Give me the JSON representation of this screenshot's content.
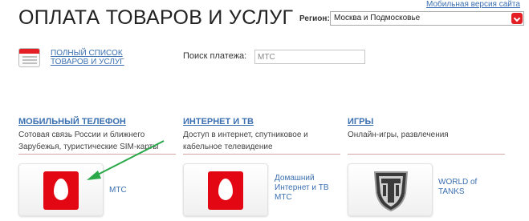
{
  "header": {
    "mobile_version": "Мобильная версия сайта",
    "title": "ОПЛАТА ТОВАРОВ И УСЛУГ",
    "region_label": "Регион:",
    "region_value": "Москва и Подмосковье"
  },
  "full_list": {
    "label": "ПОЛНЫЙ СПИСОК ТОВАРОВ И УСЛУГ"
  },
  "search": {
    "label": "Поиск платежа:",
    "value": "МТС"
  },
  "categories": [
    {
      "title": "МОБИЛЬНЫЙ ТЕЛЕФОН",
      "desc": "Сотовая связь России и ближнего Зарубежья, туристические SIM-карты"
    },
    {
      "title": "ИНТЕРНЕТ И ТВ",
      "desc": "Доступ в интернет, спутниковое и кабельное телевидение"
    },
    {
      "title": "ИГРЫ",
      "desc": "Онлайн-игры, развлечения"
    }
  ],
  "tiles": [
    {
      "label": "МТС",
      "icon": "mts-egg-logo"
    },
    {
      "label": "Домашний Интернет и ТВ МТС",
      "icon": "mts-egg-logo"
    },
    {
      "label": "WORLD of TANKS",
      "icon": "world-of-tanks-logo"
    }
  ],
  "colors": {
    "accent_red": "#e31e24",
    "link_blue": "#3a6fb0",
    "arrow_green": "#2aa84a"
  }
}
